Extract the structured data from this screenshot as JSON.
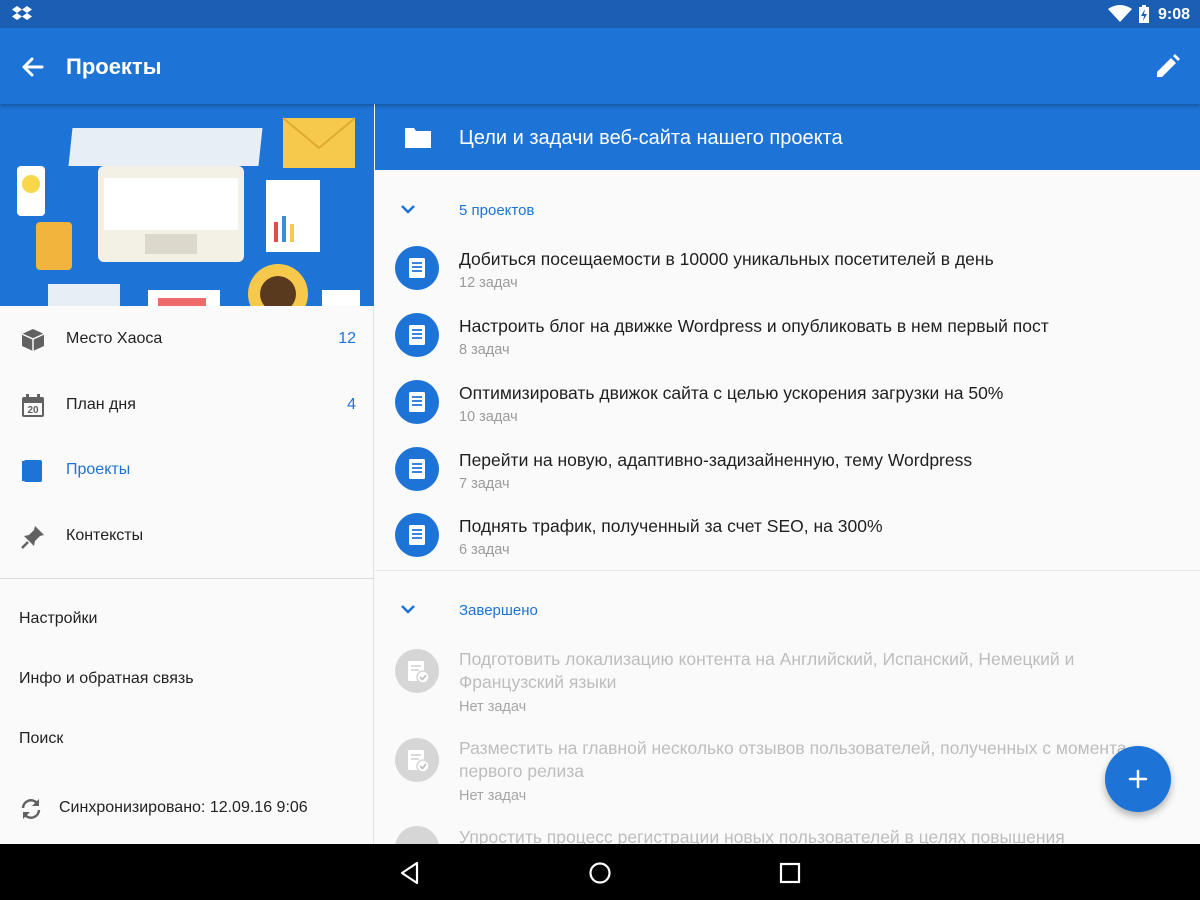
{
  "status_bar": {
    "time": "9:08",
    "icons": [
      "dropbox-icon",
      "wifi-icon",
      "battery-charging-icon"
    ]
  },
  "app_bar": {
    "title": "Проекты",
    "icons": [
      "back-arrow-icon",
      "edit-pencil-icon"
    ]
  },
  "drawer": {
    "items": [
      {
        "label": "Место Хаоса",
        "count": "12",
        "icon": "inbox-box-icon"
      },
      {
        "label": "План дня",
        "count": "4",
        "icon": "calendar-icon",
        "icon_text": "20"
      },
      {
        "label": "Проекты",
        "count": "",
        "icon": "notebook-icon",
        "active": true
      },
      {
        "label": "Контексты",
        "count": "",
        "icon": "pin-icon"
      }
    ],
    "secondary": [
      "Настройки",
      "Инфо и обратная связь",
      "Поиск"
    ],
    "sync": {
      "label": "Синхронизировано: 12.09.16 9:06",
      "icon": "sync-icon"
    }
  },
  "main": {
    "project_title": "Цели и задачи веб-сайта нашего проекта",
    "active_group": {
      "label": "5 проектов",
      "items": [
        {
          "title": "Добиться посещаемости в 10000 уникальных посетителей в день",
          "subtitle": "12 задач"
        },
        {
          "title": "Настроить блог на движке Wordpress и опубликовать в нем первый пост",
          "subtitle": "8 задач"
        },
        {
          "title": "Оптимизировать движок сайта с целью ускорения загрузки на 50%",
          "subtitle": "10 задач"
        },
        {
          "title": "Перейти на новую, адаптивно-задизайненную, тему Wordpress",
          "subtitle": "7 задач"
        },
        {
          "title": "Поднять трафик, полученный за счет SEO, на 300%",
          "subtitle": "6 задач"
        }
      ]
    },
    "completed_group": {
      "label": "Завершено",
      "items": [
        {
          "title": "Подготовить локализацию контента на Английский, Испанский, Немецкий и Французский языки",
          "subtitle": "Нет задач"
        },
        {
          "title": "Разместить на главной несколько отзывов пользователей, полученных с момента первого релиза",
          "subtitle": "Нет задач"
        },
        {
          "title": "Упростить процесс регистрации новых пользователей в целях повышения",
          "subtitle": ""
        }
      ]
    }
  },
  "fab": {
    "icon": "plus-icon"
  },
  "nav_bar": {
    "icons": [
      "back-triangle-icon",
      "home-circle-icon",
      "recents-square-icon"
    ]
  },
  "colors": {
    "primary": "#1e73d6",
    "status_bar": "#1a5fb4",
    "accent_text": "#1e73d6",
    "completed": "#d6d6d6"
  }
}
